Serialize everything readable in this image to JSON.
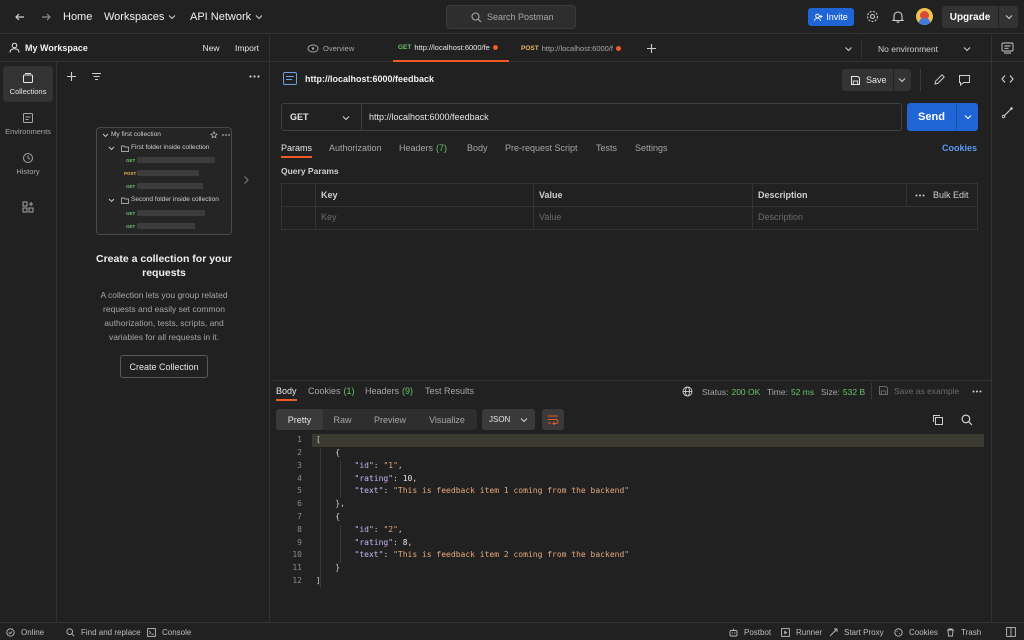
{
  "topbar": {
    "home": "Home",
    "workspaces": "Workspaces",
    "api_network": "API Network",
    "search_placeholder": "Search Postman",
    "invite": "Invite",
    "upgrade": "Upgrade"
  },
  "sidebar": {
    "workspace_name": "My Workspace",
    "new_label": "New",
    "import_label": "Import",
    "rail": [
      {
        "label": "Collections",
        "icon": "collections-icon"
      },
      {
        "label": "Environments",
        "icon": "environments-icon"
      },
      {
        "label": "History",
        "icon": "history-icon"
      }
    ],
    "illustration": {
      "collection": "My first collection",
      "folder1": "First folder inside collection",
      "folder2": "Second folder inside collection",
      "methods": [
        "GET",
        "POST",
        "GET",
        "GET",
        "GET"
      ]
    },
    "empty_title": "Create a collection for your requests",
    "empty_desc": "A collection lets you group related requests and easily set common authorization, tests, scripts, and variables for all requests in it.",
    "create_button": "Create Collection"
  },
  "tabs": {
    "overview": "Overview",
    "tab1_method": "GET",
    "tab1_url": "http://localhost:6000/fe",
    "tab2_method": "POST",
    "tab2_url": "http://localhost:6000/f",
    "environment": "No environment"
  },
  "request": {
    "title": "http://localhost:6000/feedback",
    "save": "Save",
    "method": "GET",
    "url": "http://localhost:6000/feedback",
    "send": "Send",
    "tabs": {
      "params": "Params",
      "authorization": "Authorization",
      "headers": "Headers",
      "headers_count": "(7)",
      "body": "Body",
      "prerequest": "Pre-request Script",
      "tests": "Tests",
      "settings": "Settings"
    },
    "cookies": "Cookies",
    "query_params": "Query Params",
    "table": {
      "key": "Key",
      "value": "Value",
      "description": "Description",
      "bulk_edit": "Bulk Edit",
      "key_ph": "Key",
      "value_ph": "Value",
      "desc_ph": "Description"
    }
  },
  "response": {
    "tabs": {
      "body": "Body",
      "cookies": "Cookies",
      "cookies_count": "(1)",
      "headers": "Headers",
      "headers_count": "(9)",
      "test_results": "Test Results"
    },
    "status_label": "Status:",
    "status_value": "200 OK",
    "time_label": "Time:",
    "time_value": "52 ms",
    "size_label": "Size:",
    "size_value": "532 B",
    "save_example": "Save as example",
    "view": {
      "pretty": "Pretty",
      "raw": "Raw",
      "preview": "Preview",
      "visualize": "Visualize",
      "format": "JSON"
    },
    "line_numbers": [
      "1",
      "2",
      "3",
      "4",
      "5",
      "6",
      "7",
      "8",
      "9",
      "10",
      "11",
      "12"
    ],
    "items": [
      {
        "id": "\"1\"",
        "rating": "10",
        "text": "\"This is feedback item 1 coming from the backend\""
      },
      {
        "id": "\"2\"",
        "rating": "8",
        "text": "\"This is feedback item 2 coming from the backend\""
      }
    ]
  },
  "statusbar": {
    "online": "Online",
    "find_replace": "Find and replace",
    "console": "Console",
    "postbot": "Postbot",
    "runner": "Runner",
    "start_proxy": "Start Proxy",
    "cookies": "Cookies",
    "trash": "Trash"
  }
}
